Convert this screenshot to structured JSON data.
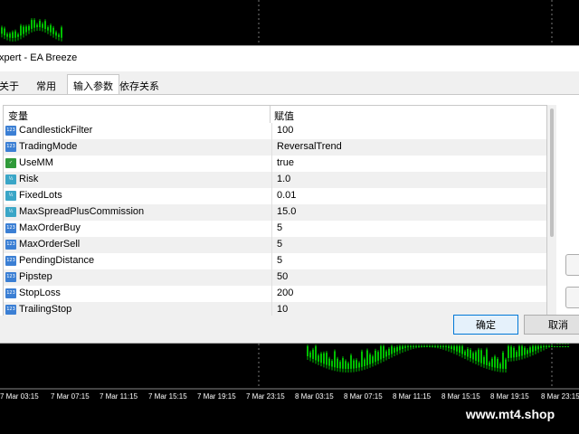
{
  "dialog": {
    "title": "xpert - EA Breeze",
    "tabs": [
      {
        "label": "关于",
        "active": false
      },
      {
        "label": "常用",
        "active": false
      },
      {
        "label": "输入参数",
        "active": true
      },
      {
        "label": "依存关系",
        "active": false
      }
    ],
    "columns": {
      "name": "变量",
      "value": "赋值"
    },
    "params": [
      {
        "icon": "int-icon",
        "name": "CandlestickFilter",
        "value": "100"
      },
      {
        "icon": "int-icon",
        "name": "TradingMode",
        "value": "ReversalTrend"
      },
      {
        "icon": "bool-icon",
        "name": "UseMM",
        "value": "true"
      },
      {
        "icon": "double-icon",
        "name": "Risk",
        "value": "1.0"
      },
      {
        "icon": "double-icon",
        "name": "FixedLots",
        "value": "0.01"
      },
      {
        "icon": "double-icon",
        "name": "MaxSpreadPlusCommission",
        "value": "15.0"
      },
      {
        "icon": "int-icon",
        "name": "MaxOrderBuy",
        "value": "5"
      },
      {
        "icon": "int-icon",
        "name": "MaxOrderSell",
        "value": "5"
      },
      {
        "icon": "int-icon",
        "name": "PendingDistance",
        "value": "5"
      },
      {
        "icon": "int-icon",
        "name": "Pipstep",
        "value": "50"
      },
      {
        "icon": "int-icon",
        "name": "StopLoss",
        "value": "200"
      },
      {
        "icon": "int-icon",
        "name": "TrailingStop",
        "value": "10"
      }
    ],
    "ok_label": "确定",
    "cancel_label": "取消"
  },
  "chart": {
    "time_labels": [
      "7 Mar 03:15",
      "7 Mar 07:15",
      "7 Mar 11:15",
      "7 Mar 15:15",
      "7 Mar 19:15",
      "7 Mar 23:15",
      "8 Mar 03:15",
      "8 Mar 07:15",
      "8 Mar 11:15",
      "8 Mar 15:15",
      "8 Mar 19:15",
      "8 Mar 23:15"
    ],
    "bull_color": "#00c000",
    "bg_color": "#000000"
  },
  "watermark": "www.mt4.shop"
}
